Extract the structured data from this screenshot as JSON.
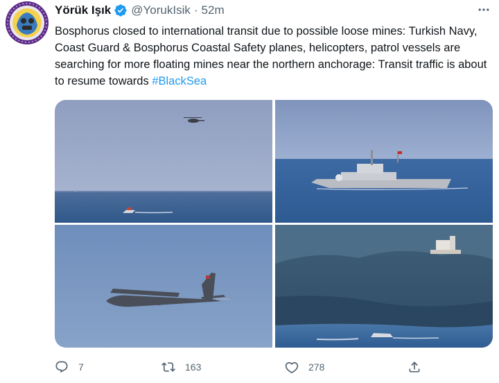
{
  "user": {
    "display_name": "Yörük Işık",
    "handle": "@YorukIsik",
    "separator": "·",
    "time": "52m",
    "verified_icon": "verified-badge-icon",
    "avatar_icon": "avatar-logo-icon"
  },
  "tweet": {
    "text": "Bosphorus closed to international transit due to possible loose mines: Turkish Navy, Coast Guard & Bosphorus Coastal Safety planes, helicopters, patrol vessels are searching for more floating mines near the northern anchorage: Transit traffic is about to resume towards ",
    "hashtag": "#BlackSea"
  },
  "media": [
    {
      "subject": "helicopter-and-boat-photo"
    },
    {
      "subject": "navy-ship-photo"
    },
    {
      "subject": "patrol-plane-photo"
    },
    {
      "subject": "coastline-boat-photo"
    }
  ],
  "actions": {
    "reply": {
      "icon": "reply-icon",
      "count": "7"
    },
    "retweet": {
      "icon": "retweet-icon",
      "count": "163"
    },
    "like": {
      "icon": "heart-icon",
      "count": "278"
    },
    "share": {
      "icon": "share-icon",
      "count": ""
    }
  },
  "colors": {
    "accent": "#1d9bf0",
    "text": "#0f1419",
    "muted": "#536471"
  }
}
